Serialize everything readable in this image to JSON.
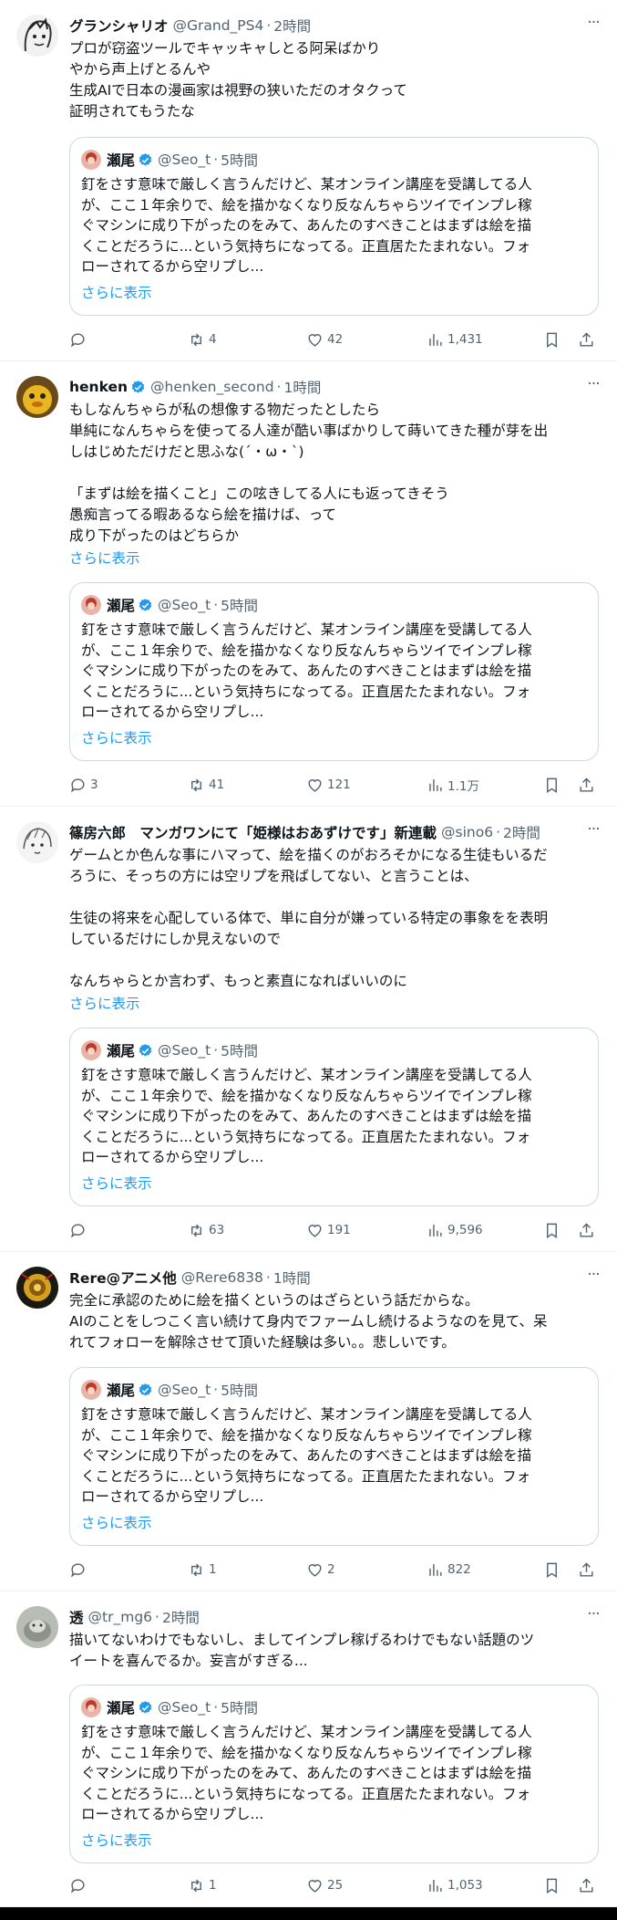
{
  "quote": {
    "name": "瀬尾",
    "handle": "@Seo_t",
    "time": "5時間",
    "lines": [
      "釘をさす意味で厳しく言うんだけど、某オンライン講座を受講してる人",
      "が、ここ１年余りで、絵を描かなくなり反なんちゃらツイでインプレ稼",
      "ぐマシンに成り下がったのをみて、あんたのすべきことはまずは絵を描",
      "くことだろうに...という気持ちになってる。正直居たたまれない。フォ",
      "ローされてるから空リプし..."
    ],
    "show_more": "さらに表示"
  },
  "tweets": [
    {
      "name": "グランシャリオ",
      "handle": "@Grand_PS4",
      "time": "2時間",
      "lines": [
        "プロが窃盗ツールでキャッキャしとる阿呆ばかり",
        "やから声上げとるんや",
        "生成AIで日本の漫画家は視野の狭いただのオタクって",
        "証明されてもうたな"
      ],
      "show_more": "",
      "stats": {
        "reply": "",
        "retweet": "4",
        "like": "42",
        "views": "1,431"
      }
    },
    {
      "name": "henken",
      "handle": "@henken_second",
      "time": "1時間",
      "lines": [
        "もしなんちゃらが私の想像する物だったとしたら",
        "単純になんちゃらを使ってる人達が酷い事ばかりして蒔いてきた種が芽を出",
        "しはじめただけだと思ふな(´・ω・`)",
        "",
        "「まずは絵を描くこと」この呟きしてる人にも返ってきそう",
        "愚痴言ってる暇あるなら絵を描けば、って",
        "成り下がったのはどちらか"
      ],
      "show_more": "さらに表示",
      "stats": {
        "reply": "3",
        "retweet": "41",
        "like": "121",
        "views": "1.1万"
      }
    },
    {
      "name": "篠房六郎　マンガワンにて「姫様はおあずけです」新連載",
      "handle": "@sino6",
      "time": "2時間",
      "lines": [
        "ゲームとか色んな事にハマって、絵を描くのがおろそかになる生徒もいるだ",
        "ろうに、そっちの方には空リプを飛ばしてない、と言うことは、",
        "",
        "生徒の将来を心配している体で、単に自分が嫌っている特定の事象をを表明",
        "しているだけにしか見えないので",
        "",
        "なんちゃらとか言わず、もっと素直になればいいのに"
      ],
      "show_more": "さらに表示",
      "stats": {
        "reply": "",
        "retweet": "63",
        "like": "191",
        "views": "9,596"
      }
    },
    {
      "name": "Rere@アニメ他",
      "handle": "@Rere6838",
      "time": "1時間",
      "lines": [
        "完全に承認のために絵を描くというのはざらという話だからな。",
        "AIのことをしつこく言い続けて身内でファームし続けるようなのを見て、呆",
        "れてフォローを解除させて頂いた経験は多い。。悲しいです。"
      ],
      "show_more": "",
      "stats": {
        "reply": "",
        "retweet": "1",
        "like": "2",
        "views": "822"
      }
    },
    {
      "name": "透",
      "handle": "@tr_mg6",
      "time": "2時間",
      "lines": [
        "描いてないわけでもないし、ましてインプレ稼げるわけでもない話題のツ",
        "イートを喜んでるか。妄言がすぎる..."
      ],
      "show_more": "",
      "stats": {
        "reply": "",
        "retweet": "1",
        "like": "25",
        "views": "1,053"
      }
    }
  ],
  "colors": {
    "accent": "#1d9bf0",
    "muted": "#536471",
    "text": "#0f1419",
    "border": "#cfd9de"
  },
  "icons": [
    "more-icon",
    "verified-badge-icon",
    "reply-icon",
    "retweet-icon",
    "like-icon",
    "views-icon",
    "bookmark-icon",
    "share-icon"
  ]
}
